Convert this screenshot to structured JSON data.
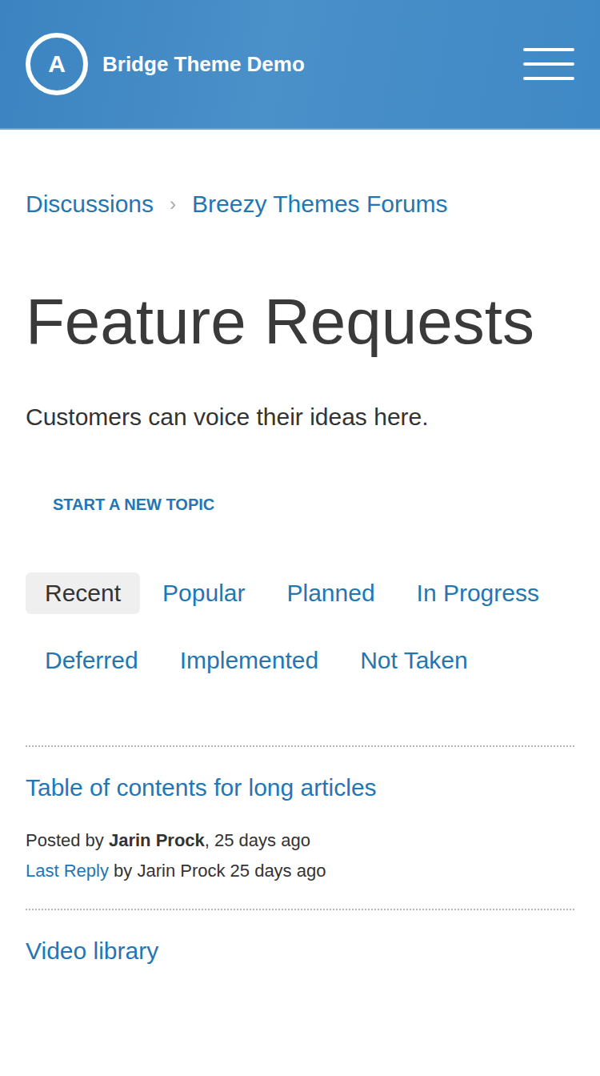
{
  "header": {
    "logo_letter": "A",
    "title": "Bridge Theme Demo"
  },
  "breadcrumbs": {
    "items": [
      "Discussions",
      "Breezy Themes Forums"
    ],
    "separator": "›"
  },
  "page": {
    "title": "Feature Requests",
    "description": "Customers can voice their ideas here.",
    "action": "START A NEW TOPIC"
  },
  "tabs": [
    {
      "label": "Recent",
      "selected": true
    },
    {
      "label": "Popular",
      "selected": false
    },
    {
      "label": "Planned",
      "selected": false
    },
    {
      "label": "In Progress",
      "selected": false
    },
    {
      "label": "Deferred",
      "selected": false
    },
    {
      "label": "Implemented",
      "selected": false
    },
    {
      "label": "Not Taken",
      "selected": false
    }
  ],
  "topics": [
    {
      "title": "Table of contents for long articles",
      "posted_prefix": "Posted by",
      "author": "Jarin Prock",
      "posted_suffix": ", 25 days ago",
      "last_reply_link": "Last Reply",
      "last_reply_text": "by Jarin Prock 25 days ago"
    },
    {
      "title": "Video library"
    }
  ]
}
